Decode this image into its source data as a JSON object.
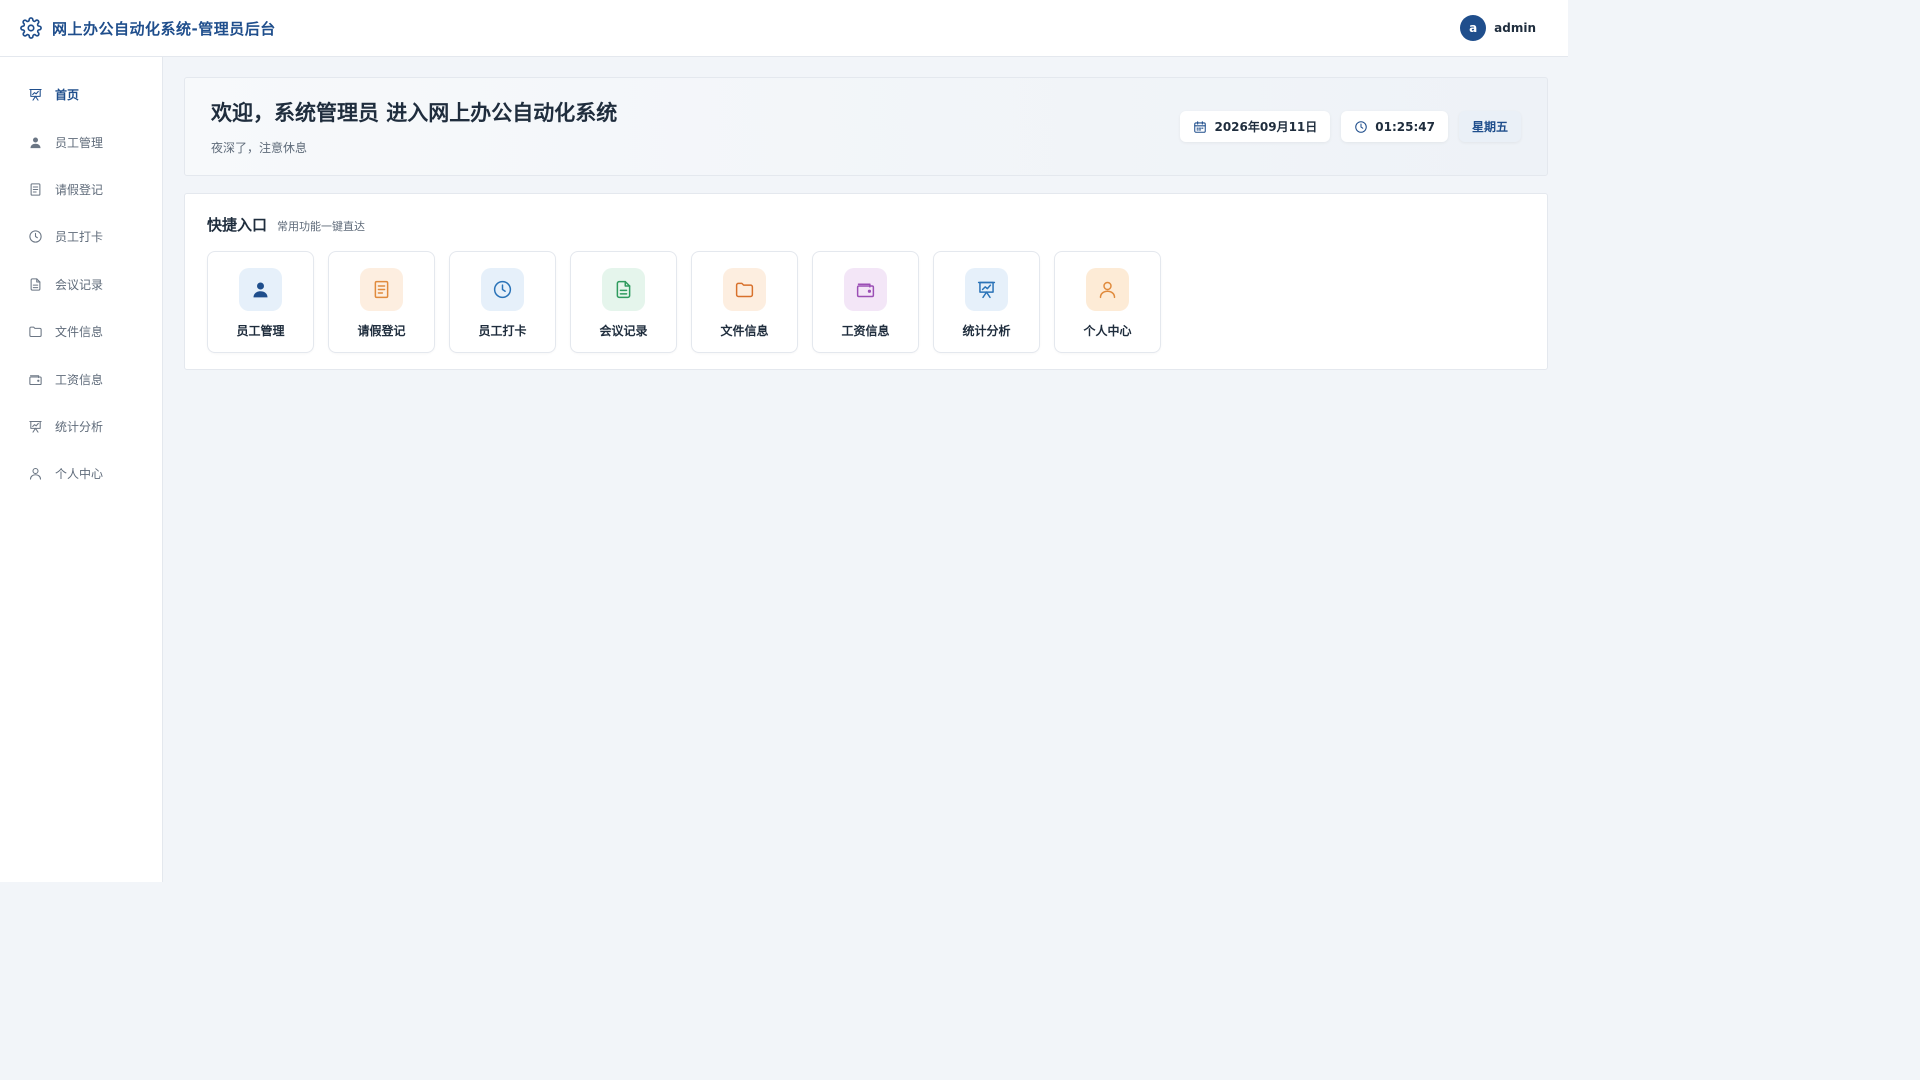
{
  "header": {
    "title": "网上办公自动化系统-管理员后台",
    "avatar_letter": "a",
    "username": "admin"
  },
  "sidebar": {
    "items": [
      {
        "label": "首页",
        "icon": "presentation-chart-icon",
        "active": true
      },
      {
        "label": "员工管理",
        "icon": "user-icon"
      },
      {
        "label": "请假登记",
        "icon": "document-icon"
      },
      {
        "label": "员工打卡",
        "icon": "clock-icon"
      },
      {
        "label": "会议记录",
        "icon": "file-text-icon"
      },
      {
        "label": "文件信息",
        "icon": "folder-icon"
      },
      {
        "label": "工资信息",
        "icon": "wallet-icon"
      },
      {
        "label": "统计分析",
        "icon": "presentation-chart-icon"
      },
      {
        "label": "个人中心",
        "icon": "user-outline-icon"
      }
    ]
  },
  "welcome": {
    "title": "欢迎，系统管理员 进入网上办公自动化系统",
    "subtitle": "夜深了，注意休息",
    "date": "2026年09月11日",
    "time": "01:25:47",
    "weekday": "星期五"
  },
  "quick": {
    "title": "快捷入口",
    "subtitle": "常用功能一键直达",
    "cards": [
      {
        "label": "员工管理",
        "icon": "user-icon",
        "bg": "#e6f0fa",
        "fg": "#1f4e8c"
      },
      {
        "label": "请假登记",
        "icon": "document-icon",
        "bg": "#fdeee0",
        "fg": "#e08a3c"
      },
      {
        "label": "员工打卡",
        "icon": "clock-icon",
        "bg": "#e6f0fa",
        "fg": "#2a73b8"
      },
      {
        "label": "会议记录",
        "icon": "file-text-icon",
        "bg": "#e5f5ec",
        "fg": "#2e9b5e"
      },
      {
        "label": "文件信息",
        "icon": "folder-icon",
        "bg": "#fdeee0",
        "fg": "#d8712c"
      },
      {
        "label": "工资信息",
        "icon": "wallet-icon",
        "bg": "#f3e6f7",
        "fg": "#9b4fb5"
      },
      {
        "label": "统计分析",
        "icon": "presentation-chart-icon",
        "bg": "#e6f0fa",
        "fg": "#2a73b8"
      },
      {
        "label": "个人中心",
        "icon": "user-outline-icon",
        "bg": "#fdebd6",
        "fg": "#e08a3c"
      }
    ]
  },
  "colors": {
    "primary": "#1f4e8c",
    "background": "#f2f5f9"
  }
}
